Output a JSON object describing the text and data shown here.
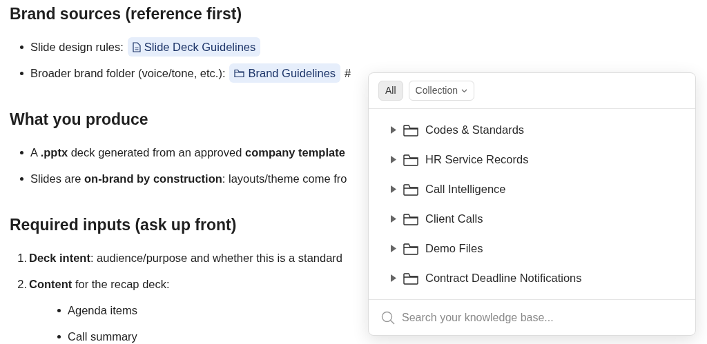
{
  "document": {
    "sections": [
      {
        "heading": "Brand sources (reference first)",
        "items": [
          {
            "text": "Slide design rules:",
            "chip": {
              "kind": "document",
              "label": "Slide Deck Guidelines"
            }
          },
          {
            "text": "Broader brand folder (voice/tone, etc.):",
            "chip": {
              "kind": "folder",
              "label": "Brand Guidelines"
            },
            "after": "#"
          }
        ]
      },
      {
        "heading": "What you produce",
        "items": [
          {
            "text": "A **.pptx** deck generated from an approved **company template**"
          },
          {
            "text": "Slides are **on-brand by construction**: layouts/theme come fro"
          }
        ]
      },
      {
        "heading": "Required inputs (ask up front)",
        "items": [
          {
            "number": "1.",
            "text": "**Deck intent**: audience/purpose and whether this is a standard"
          },
          {
            "number": "2.",
            "text": "**Content** for the recap deck:",
            "children": [
              {
                "text": "Agenda items"
              },
              {
                "text": "Call summary"
              }
            ]
          }
        ]
      }
    ]
  },
  "picker": {
    "filters": [
      {
        "kind": "toggle",
        "label": "All",
        "selected": true
      },
      {
        "kind": "dropdown",
        "label": "Collection",
        "selected": false
      }
    ],
    "folders": [
      {
        "label": "Codes & Standards",
        "expanded": false
      },
      {
        "label": "HR Service Records",
        "expanded": false
      },
      {
        "label": "Call Intelligence",
        "expanded": false
      },
      {
        "label": "Client Calls",
        "expanded": false
      },
      {
        "label": "Demo Files",
        "expanded": false
      },
      {
        "label": "Contract Deadline Notifications",
        "expanded": false
      }
    ],
    "search": {
      "placeholder": "Search your knowledge base..."
    }
  }
}
